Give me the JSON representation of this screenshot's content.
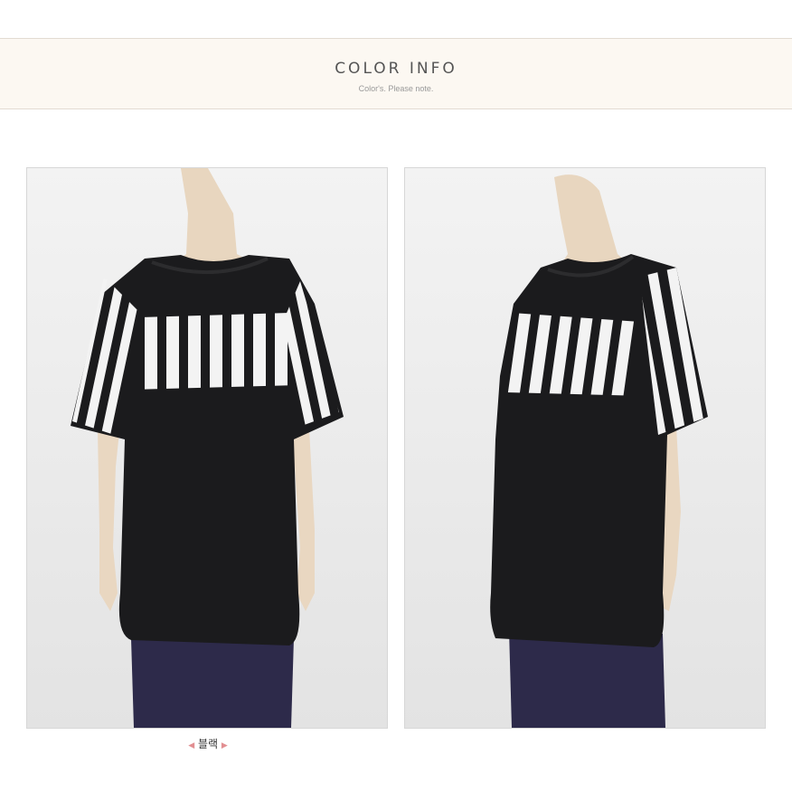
{
  "banner": {
    "title": "COLOR INFO",
    "subtitle": "Color's. Please note."
  },
  "photos": [
    {
      "alt": "front-view"
    },
    {
      "alt": "side-view"
    }
  ],
  "caption": {
    "left_arrow": "◀",
    "label": "블랙",
    "right_arrow": "▶"
  },
  "colors": {
    "banner_bg": "#fcf8f2",
    "shirt": "#1b1b1d",
    "stripe": "#f3f3f3",
    "pants": "#2d2a4a"
  }
}
